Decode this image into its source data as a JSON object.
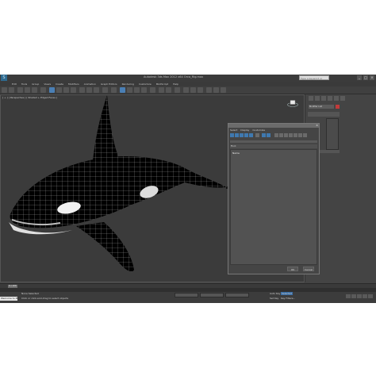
{
  "app": {
    "logo": "S",
    "title": "Autodesk 3ds Max 2012 x64     Orca_Rig.max",
    "search_placeholder": "Type a keyword or phrase",
    "window_buttons": [
      "_",
      "□",
      "×"
    ]
  },
  "menubar": [
    "Edit",
    "Tools",
    "Group",
    "Views",
    "Create",
    "Modifiers",
    "Animation",
    "Graph Editors",
    "Rendering",
    "Customize",
    "MAXScript",
    "Help"
  ],
  "viewport": {
    "label": "[ + ] [ Perspective ] [ Shaded + Edged Faces ]",
    "subject": "orca whale wireframe mesh"
  },
  "command_panel": {
    "name_field": "Modifier List"
  },
  "dialog": {
    "title": "Select From Scene",
    "menus": [
      "Select",
      "Display",
      "Customize"
    ],
    "filter_label": "Find:",
    "column_header": "Name",
    "ok_label": "OK",
    "cancel_label": "Cancel"
  },
  "timeline": {
    "slider_label": "0 / 100"
  },
  "statusbar": {
    "welcome": "Welcome to M",
    "selection_status": "None Selected",
    "prompt": "Click or click-and-drag to select objects",
    "auto_key": "Auto Key",
    "selected": "Selected",
    "set_key": "Set Key",
    "key_filters": "Key Filters..."
  },
  "colors": {
    "accent": "#4a7fb5",
    "ui_bg": "#444444",
    "viewport_bg": "#3b3b3b"
  }
}
